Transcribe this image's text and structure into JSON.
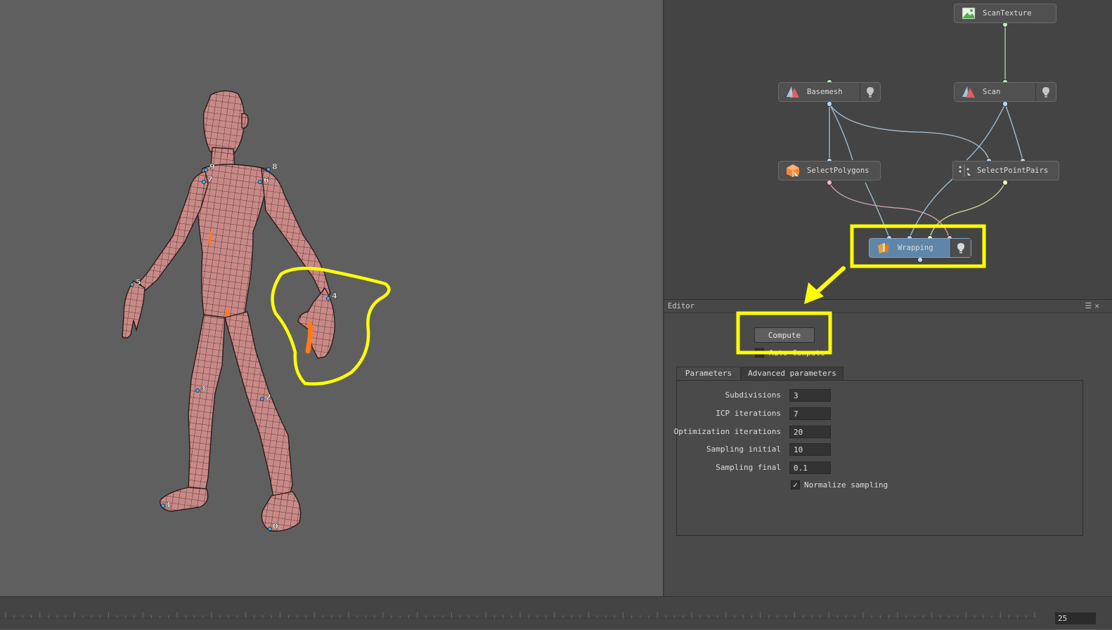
{
  "viewport": {
    "joint_labels": [
      "9",
      "8",
      "7",
      "6",
      "5",
      "4",
      "3",
      "2",
      "1",
      "0"
    ]
  },
  "graph": {
    "nodes": {
      "scan_texture": "ScanTexture",
      "basemesh": "Basemesh",
      "scan": "Scan",
      "select_polygons": "SelectPolygons",
      "select_point_pairs": "SelectPointPairs",
      "wrapping": "Wrapping"
    }
  },
  "editor": {
    "title": "Editor",
    "compute_label": "Compute",
    "auto_compute_label": "Auto Compute",
    "tabs": [
      "Parameters",
      "Advanced parameters"
    ],
    "params": [
      {
        "label": "Subdivisions",
        "value": "3"
      },
      {
        "label": "ICP iterations",
        "value": "7"
      },
      {
        "label": "Optimization iterations",
        "value": "20"
      },
      {
        "label": "Sampling initial",
        "value": "10"
      },
      {
        "label": "Sampling final",
        "value": "0.1"
      }
    ],
    "normalize_label": "Normalize sampling",
    "normalize_checked": true
  },
  "timeline": {
    "frame": "25"
  },
  "colors": {
    "highlight": "#ffff00",
    "mesh": "#c98a87",
    "wire": "#2a1a1a",
    "selection": "#ff7a1a",
    "node_selected": "#5f86a8"
  },
  "icons": [
    "mesh-icon",
    "texture-icon",
    "select-polygons-icon",
    "select-point-pairs-icon",
    "wrapping-icon",
    "bulb-icon",
    "menu-icon",
    "close-icon",
    "checkmark-icon"
  ]
}
